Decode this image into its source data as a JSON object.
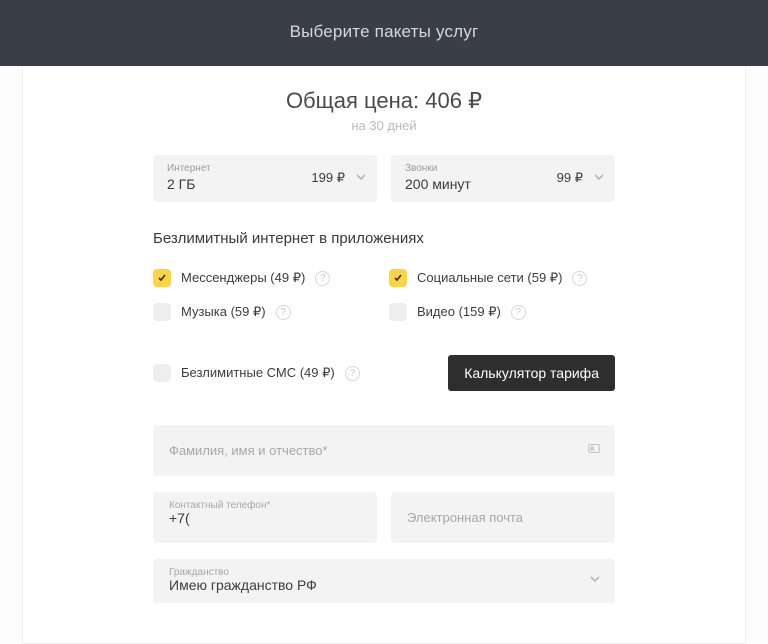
{
  "header": {
    "title": "Выберите пакеты услуг"
  },
  "price": {
    "label_prefix": "Общая цена: ",
    "amount": "406 ₽",
    "period": "на 30 дней"
  },
  "selectors": {
    "internet": {
      "label": "Интернет",
      "value": "2 ГБ",
      "price": "199 ₽"
    },
    "calls": {
      "label": "Звонки",
      "value": "200 минут",
      "price": "99 ₽"
    }
  },
  "unlimited": {
    "title": "Безлимитный интернет в приложениях",
    "options": {
      "messengers": {
        "label": "Мессенджеры (49 ₽)",
        "checked": true
      },
      "social": {
        "label": "Социальные сети (59 ₽)",
        "checked": true
      },
      "music": {
        "label": "Музыка (59 ₽)",
        "checked": false
      },
      "video": {
        "label": "Видео (159 ₽)",
        "checked": false
      }
    }
  },
  "sms": {
    "label": "Безлимитные СМС (49 ₽)",
    "checked": false
  },
  "tariff_button": "Калькулятор тарифа",
  "form": {
    "fio_placeholder": "Фамилия, имя и отчество*",
    "phone_label": "Контактный телефон*",
    "phone_value": "+7(",
    "email_placeholder": "Электронная почта",
    "citizenship_label": "Гражданство",
    "citizenship_value": "Имею гражданство РФ"
  }
}
